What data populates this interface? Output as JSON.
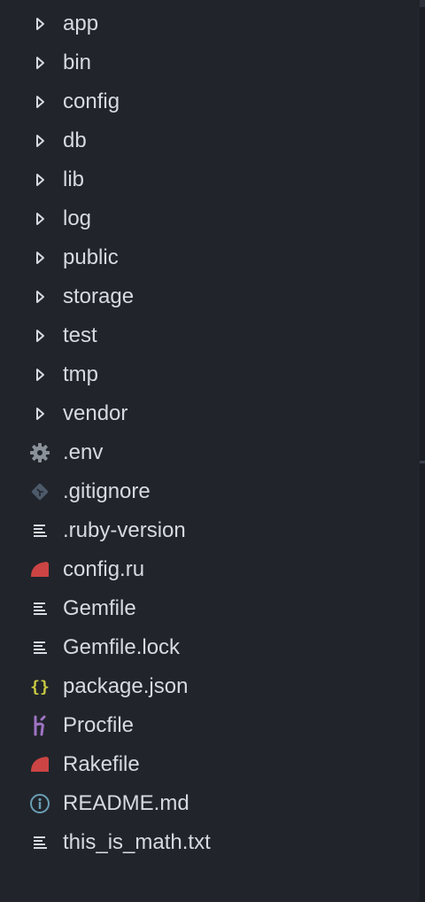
{
  "explorer": {
    "items": [
      {
        "label": "app",
        "kind": "folder",
        "icon": "chevron-right-icon"
      },
      {
        "label": "bin",
        "kind": "folder",
        "icon": "chevron-right-icon"
      },
      {
        "label": "config",
        "kind": "folder",
        "icon": "chevron-right-icon"
      },
      {
        "label": "db",
        "kind": "folder",
        "icon": "chevron-right-icon"
      },
      {
        "label": "lib",
        "kind": "folder",
        "icon": "chevron-right-icon"
      },
      {
        "label": "log",
        "kind": "folder",
        "icon": "chevron-right-icon"
      },
      {
        "label": "public",
        "kind": "folder",
        "icon": "chevron-right-icon"
      },
      {
        "label": "storage",
        "kind": "folder",
        "icon": "chevron-right-icon"
      },
      {
        "label": "test",
        "kind": "folder",
        "icon": "chevron-right-icon"
      },
      {
        "label": "tmp",
        "kind": "folder",
        "icon": "chevron-right-icon"
      },
      {
        "label": "vendor",
        "kind": "folder",
        "icon": "chevron-right-icon"
      },
      {
        "label": ".env",
        "kind": "file",
        "icon": "gear-icon"
      },
      {
        "label": ".gitignore",
        "kind": "file",
        "icon": "git-icon"
      },
      {
        "label": ".ruby-version",
        "kind": "file",
        "icon": "text-file-icon"
      },
      {
        "label": "config.ru",
        "kind": "file",
        "icon": "ruby-icon"
      },
      {
        "label": "Gemfile",
        "kind": "file",
        "icon": "text-file-icon"
      },
      {
        "label": "Gemfile.lock",
        "kind": "file",
        "icon": "text-file-icon"
      },
      {
        "label": "package.json",
        "kind": "file",
        "icon": "json-braces-icon"
      },
      {
        "label": "Procfile",
        "kind": "file",
        "icon": "heroku-icon"
      },
      {
        "label": "Rakefile",
        "kind": "file",
        "icon": "ruby-icon"
      },
      {
        "label": "README.md",
        "kind": "file",
        "icon": "info-icon"
      },
      {
        "label": "this_is_math.txt",
        "kind": "file",
        "icon": "text-file-icon"
      }
    ]
  },
  "colors": {
    "background": "#21252b",
    "text": "#d7dae0",
    "chevron": "#d7dae0",
    "gear": "#8a9199",
    "git": "#4c5a6a",
    "text_file": "#d7dae0",
    "ruby": "#cc4444",
    "json": "#cbcb41",
    "heroku": "#a074c4",
    "info": "#6a9fb5"
  }
}
